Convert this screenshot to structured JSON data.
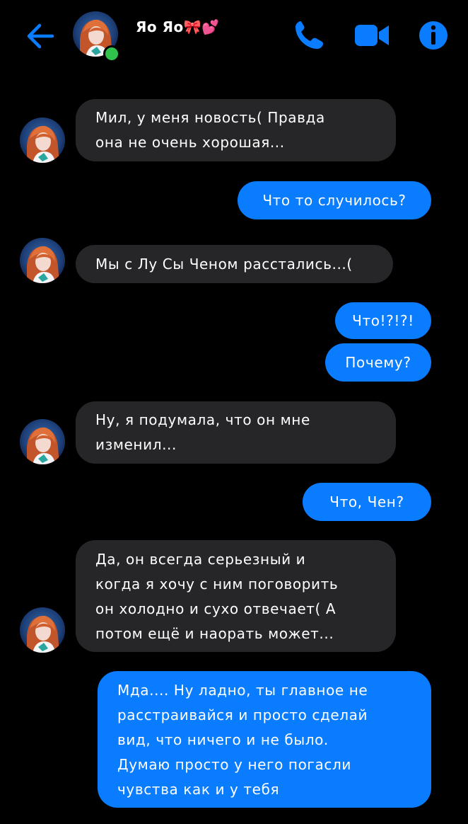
{
  "colors": {
    "accent": "#0a7cff",
    "incoming_bubble": "#262629",
    "background": "#000000",
    "online": "#31c24d"
  },
  "header": {
    "contact_name": "Яо Яо🎀💕",
    "icons": [
      "back-arrow-icon",
      "phone-icon",
      "video-camera-icon",
      "info-icon"
    ]
  },
  "messages": [
    {
      "sender": "contact",
      "lines": [
        "Мил, у меня новость( Правда",
        "она не очень хорошая..."
      ]
    },
    {
      "sender": "me",
      "lines": [
        "Что то случилось?"
      ]
    },
    {
      "sender": "contact",
      "lines": [
        "Мы с Лу Сы Ченом расстались...("
      ]
    },
    {
      "sender": "me",
      "lines": [
        "Что!?!?!"
      ]
    },
    {
      "sender": "me",
      "lines": [
        "Почему?"
      ]
    },
    {
      "sender": "contact",
      "lines": [
        "Ну, я подумала, что он мне",
        "изменил..."
      ]
    },
    {
      "sender": "me",
      "lines": [
        "Что, Чен?"
      ]
    },
    {
      "sender": "contact",
      "lines": [
        "Да, он всегда серьезный и",
        "когда я хочу с ним поговорить",
        "он холодно и сухо отвечает( А",
        "потом ещё и наорать может..."
      ]
    },
    {
      "sender": "me",
      "lines": [
        "Мда.... Ну ладно, ты главное не",
        "расстраивайся и просто сделай",
        "вид, что ничего и не было.",
        "Думаю просто у него погасли",
        "чувства как и у тебя"
      ]
    }
  ]
}
